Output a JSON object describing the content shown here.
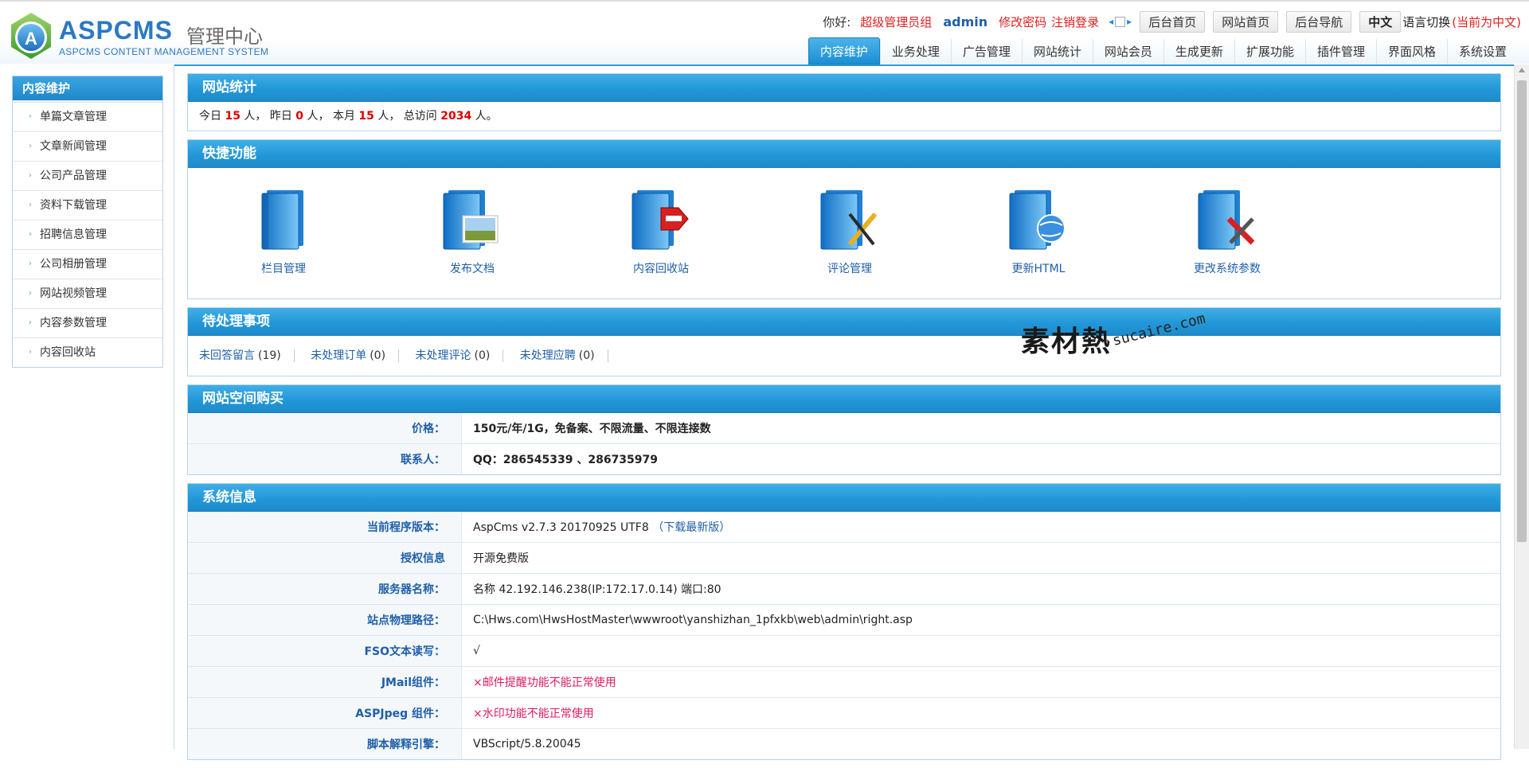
{
  "brand": {
    "name": "ASPCMS",
    "cn": "管理中心",
    "sub": "ASPCMS CONTENT MANAGEMENT SYSTEM"
  },
  "topbar": {
    "hello": "你好:",
    "role": "超级管理员组",
    "user": "admin",
    "change_pwd": "修改密码",
    "logout": "注销登录",
    "btn_admin_home": "后台首页",
    "btn_site_home": "网站首页",
    "btn_admin_nav": "后台导航",
    "btn_lang": "中文",
    "lang_switch": "语言切换",
    "lang_now": "(当前为中文)"
  },
  "mainnav": [
    "内容维护",
    "业务处理",
    "广告管理",
    "网站统计",
    "网站会员",
    "生成更新",
    "扩展功能",
    "插件管理",
    "界面风格",
    "系统设置"
  ],
  "sidebar": {
    "title": "内容维护",
    "items": [
      "单篇文章管理",
      "文章新闻管理",
      "公司产品管理",
      "资料下载管理",
      "招聘信息管理",
      "公司相册管理",
      "网站视频管理",
      "内容参数管理",
      "内容回收站"
    ]
  },
  "stats": {
    "title": "网站统计",
    "t_today": "今日",
    "today": "15",
    "t_yesterday": "人，  昨日",
    "yesterday": "0",
    "t_month": "人，  本月",
    "month": "15",
    "t_total": "人，  总访问",
    "total": "2034",
    "t_end": "人。"
  },
  "quick": {
    "title": "快捷功能",
    "items": [
      "栏目管理",
      "发布文档",
      "内容回收站",
      "评论管理",
      "更新HTML",
      "更改系统参数"
    ]
  },
  "pending": {
    "title": "待处理事项",
    "items": [
      {
        "label": "未回答留言",
        "count": "(19)"
      },
      {
        "label": "未处理订单",
        "count": "(0)"
      },
      {
        "label": "未处理评论",
        "count": "(0)"
      },
      {
        "label": "未处理应聘",
        "count": "(0)"
      }
    ]
  },
  "buy": {
    "title": "网站空间购买",
    "price_k": "价格：",
    "price_v": "150元/年/1G，免备案、不限流量、不限连接数",
    "contact_k": "联系人：",
    "contact_v": "QQ：286545339 、286735979"
  },
  "sysinfo": {
    "title": "系统信息",
    "rows": [
      {
        "k": "当前程序版本：",
        "v": "AspCms v2.7.3 20170925 UTF8",
        "extra": "（下载最新版）"
      },
      {
        "k": "授权信息",
        "v": "开源免费版"
      },
      {
        "k": "服务器名称：",
        "v": "名称 42.192.146.238(IP:172.17.0.14) 端口:80"
      },
      {
        "k": "站点物理路径：",
        "v": "C:\\Hws.com\\HwsHostMaster\\wwwroot\\yanshizhan_1pfxkb\\web\\admin\\right.asp"
      },
      {
        "k": "FSO文本读写：",
        "v": "√"
      },
      {
        "k": "JMail组件：",
        "v": "×邮件提醒功能不能正常使用"
      },
      {
        "k": "ASPJpeg 组件：",
        "v": "×水印功能不能正常使用"
      },
      {
        "k": "脚本解释引擎：",
        "v": "VBScript/5.8.20045"
      }
    ]
  },
  "watermark": {
    "cn": "素材熱",
    "en": "sucaire.com"
  },
  "colors": {
    "accent": "#1f8fd0",
    "link": "#1f5fa8",
    "red": "#e02020",
    "warn": "#e01a5c"
  }
}
